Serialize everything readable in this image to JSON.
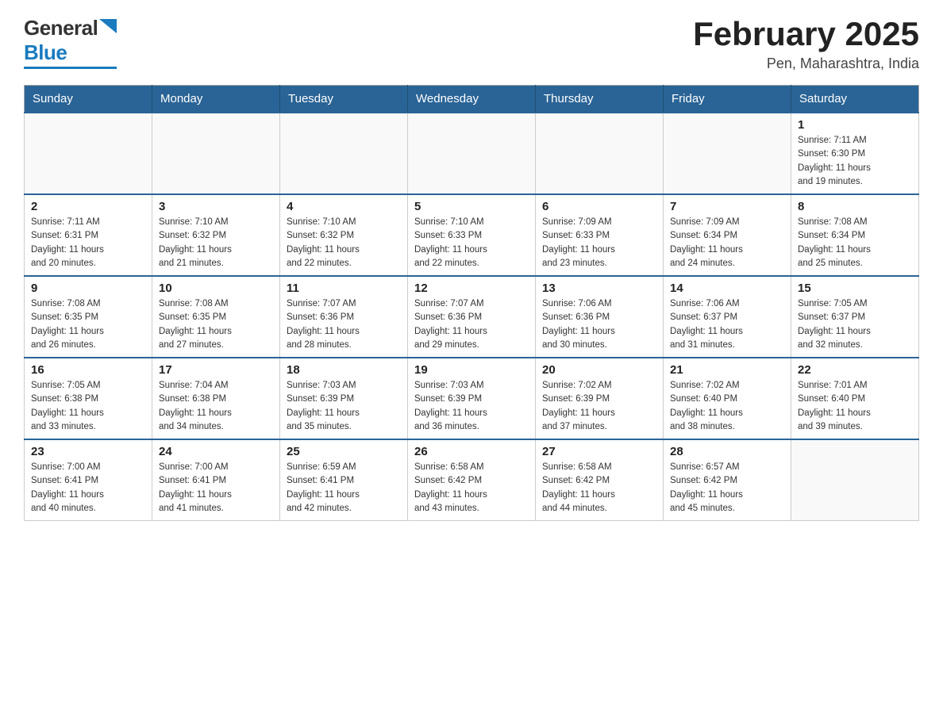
{
  "logo": {
    "general": "General",
    "blue": "Blue"
  },
  "title": "February 2025",
  "subtitle": "Pen, Maharashtra, India",
  "days_of_week": [
    "Sunday",
    "Monday",
    "Tuesday",
    "Wednesday",
    "Thursday",
    "Friday",
    "Saturday"
  ],
  "weeks": [
    [
      {
        "day": "",
        "info": ""
      },
      {
        "day": "",
        "info": ""
      },
      {
        "day": "",
        "info": ""
      },
      {
        "day": "",
        "info": ""
      },
      {
        "day": "",
        "info": ""
      },
      {
        "day": "",
        "info": ""
      },
      {
        "day": "1",
        "info": "Sunrise: 7:11 AM\nSunset: 6:30 PM\nDaylight: 11 hours\nand 19 minutes."
      }
    ],
    [
      {
        "day": "2",
        "info": "Sunrise: 7:11 AM\nSunset: 6:31 PM\nDaylight: 11 hours\nand 20 minutes."
      },
      {
        "day": "3",
        "info": "Sunrise: 7:10 AM\nSunset: 6:32 PM\nDaylight: 11 hours\nand 21 minutes."
      },
      {
        "day": "4",
        "info": "Sunrise: 7:10 AM\nSunset: 6:32 PM\nDaylight: 11 hours\nand 22 minutes."
      },
      {
        "day": "5",
        "info": "Sunrise: 7:10 AM\nSunset: 6:33 PM\nDaylight: 11 hours\nand 22 minutes."
      },
      {
        "day": "6",
        "info": "Sunrise: 7:09 AM\nSunset: 6:33 PM\nDaylight: 11 hours\nand 23 minutes."
      },
      {
        "day": "7",
        "info": "Sunrise: 7:09 AM\nSunset: 6:34 PM\nDaylight: 11 hours\nand 24 minutes."
      },
      {
        "day": "8",
        "info": "Sunrise: 7:08 AM\nSunset: 6:34 PM\nDaylight: 11 hours\nand 25 minutes."
      }
    ],
    [
      {
        "day": "9",
        "info": "Sunrise: 7:08 AM\nSunset: 6:35 PM\nDaylight: 11 hours\nand 26 minutes."
      },
      {
        "day": "10",
        "info": "Sunrise: 7:08 AM\nSunset: 6:35 PM\nDaylight: 11 hours\nand 27 minutes."
      },
      {
        "day": "11",
        "info": "Sunrise: 7:07 AM\nSunset: 6:36 PM\nDaylight: 11 hours\nand 28 minutes."
      },
      {
        "day": "12",
        "info": "Sunrise: 7:07 AM\nSunset: 6:36 PM\nDaylight: 11 hours\nand 29 minutes."
      },
      {
        "day": "13",
        "info": "Sunrise: 7:06 AM\nSunset: 6:36 PM\nDaylight: 11 hours\nand 30 minutes."
      },
      {
        "day": "14",
        "info": "Sunrise: 7:06 AM\nSunset: 6:37 PM\nDaylight: 11 hours\nand 31 minutes."
      },
      {
        "day": "15",
        "info": "Sunrise: 7:05 AM\nSunset: 6:37 PM\nDaylight: 11 hours\nand 32 minutes."
      }
    ],
    [
      {
        "day": "16",
        "info": "Sunrise: 7:05 AM\nSunset: 6:38 PM\nDaylight: 11 hours\nand 33 minutes."
      },
      {
        "day": "17",
        "info": "Sunrise: 7:04 AM\nSunset: 6:38 PM\nDaylight: 11 hours\nand 34 minutes."
      },
      {
        "day": "18",
        "info": "Sunrise: 7:03 AM\nSunset: 6:39 PM\nDaylight: 11 hours\nand 35 minutes."
      },
      {
        "day": "19",
        "info": "Sunrise: 7:03 AM\nSunset: 6:39 PM\nDaylight: 11 hours\nand 36 minutes."
      },
      {
        "day": "20",
        "info": "Sunrise: 7:02 AM\nSunset: 6:39 PM\nDaylight: 11 hours\nand 37 minutes."
      },
      {
        "day": "21",
        "info": "Sunrise: 7:02 AM\nSunset: 6:40 PM\nDaylight: 11 hours\nand 38 minutes."
      },
      {
        "day": "22",
        "info": "Sunrise: 7:01 AM\nSunset: 6:40 PM\nDaylight: 11 hours\nand 39 minutes."
      }
    ],
    [
      {
        "day": "23",
        "info": "Sunrise: 7:00 AM\nSunset: 6:41 PM\nDaylight: 11 hours\nand 40 minutes."
      },
      {
        "day": "24",
        "info": "Sunrise: 7:00 AM\nSunset: 6:41 PM\nDaylight: 11 hours\nand 41 minutes."
      },
      {
        "day": "25",
        "info": "Sunrise: 6:59 AM\nSunset: 6:41 PM\nDaylight: 11 hours\nand 42 minutes."
      },
      {
        "day": "26",
        "info": "Sunrise: 6:58 AM\nSunset: 6:42 PM\nDaylight: 11 hours\nand 43 minutes."
      },
      {
        "day": "27",
        "info": "Sunrise: 6:58 AM\nSunset: 6:42 PM\nDaylight: 11 hours\nand 44 minutes."
      },
      {
        "day": "28",
        "info": "Sunrise: 6:57 AM\nSunset: 6:42 PM\nDaylight: 11 hours\nand 45 minutes."
      },
      {
        "day": "",
        "info": ""
      }
    ]
  ]
}
